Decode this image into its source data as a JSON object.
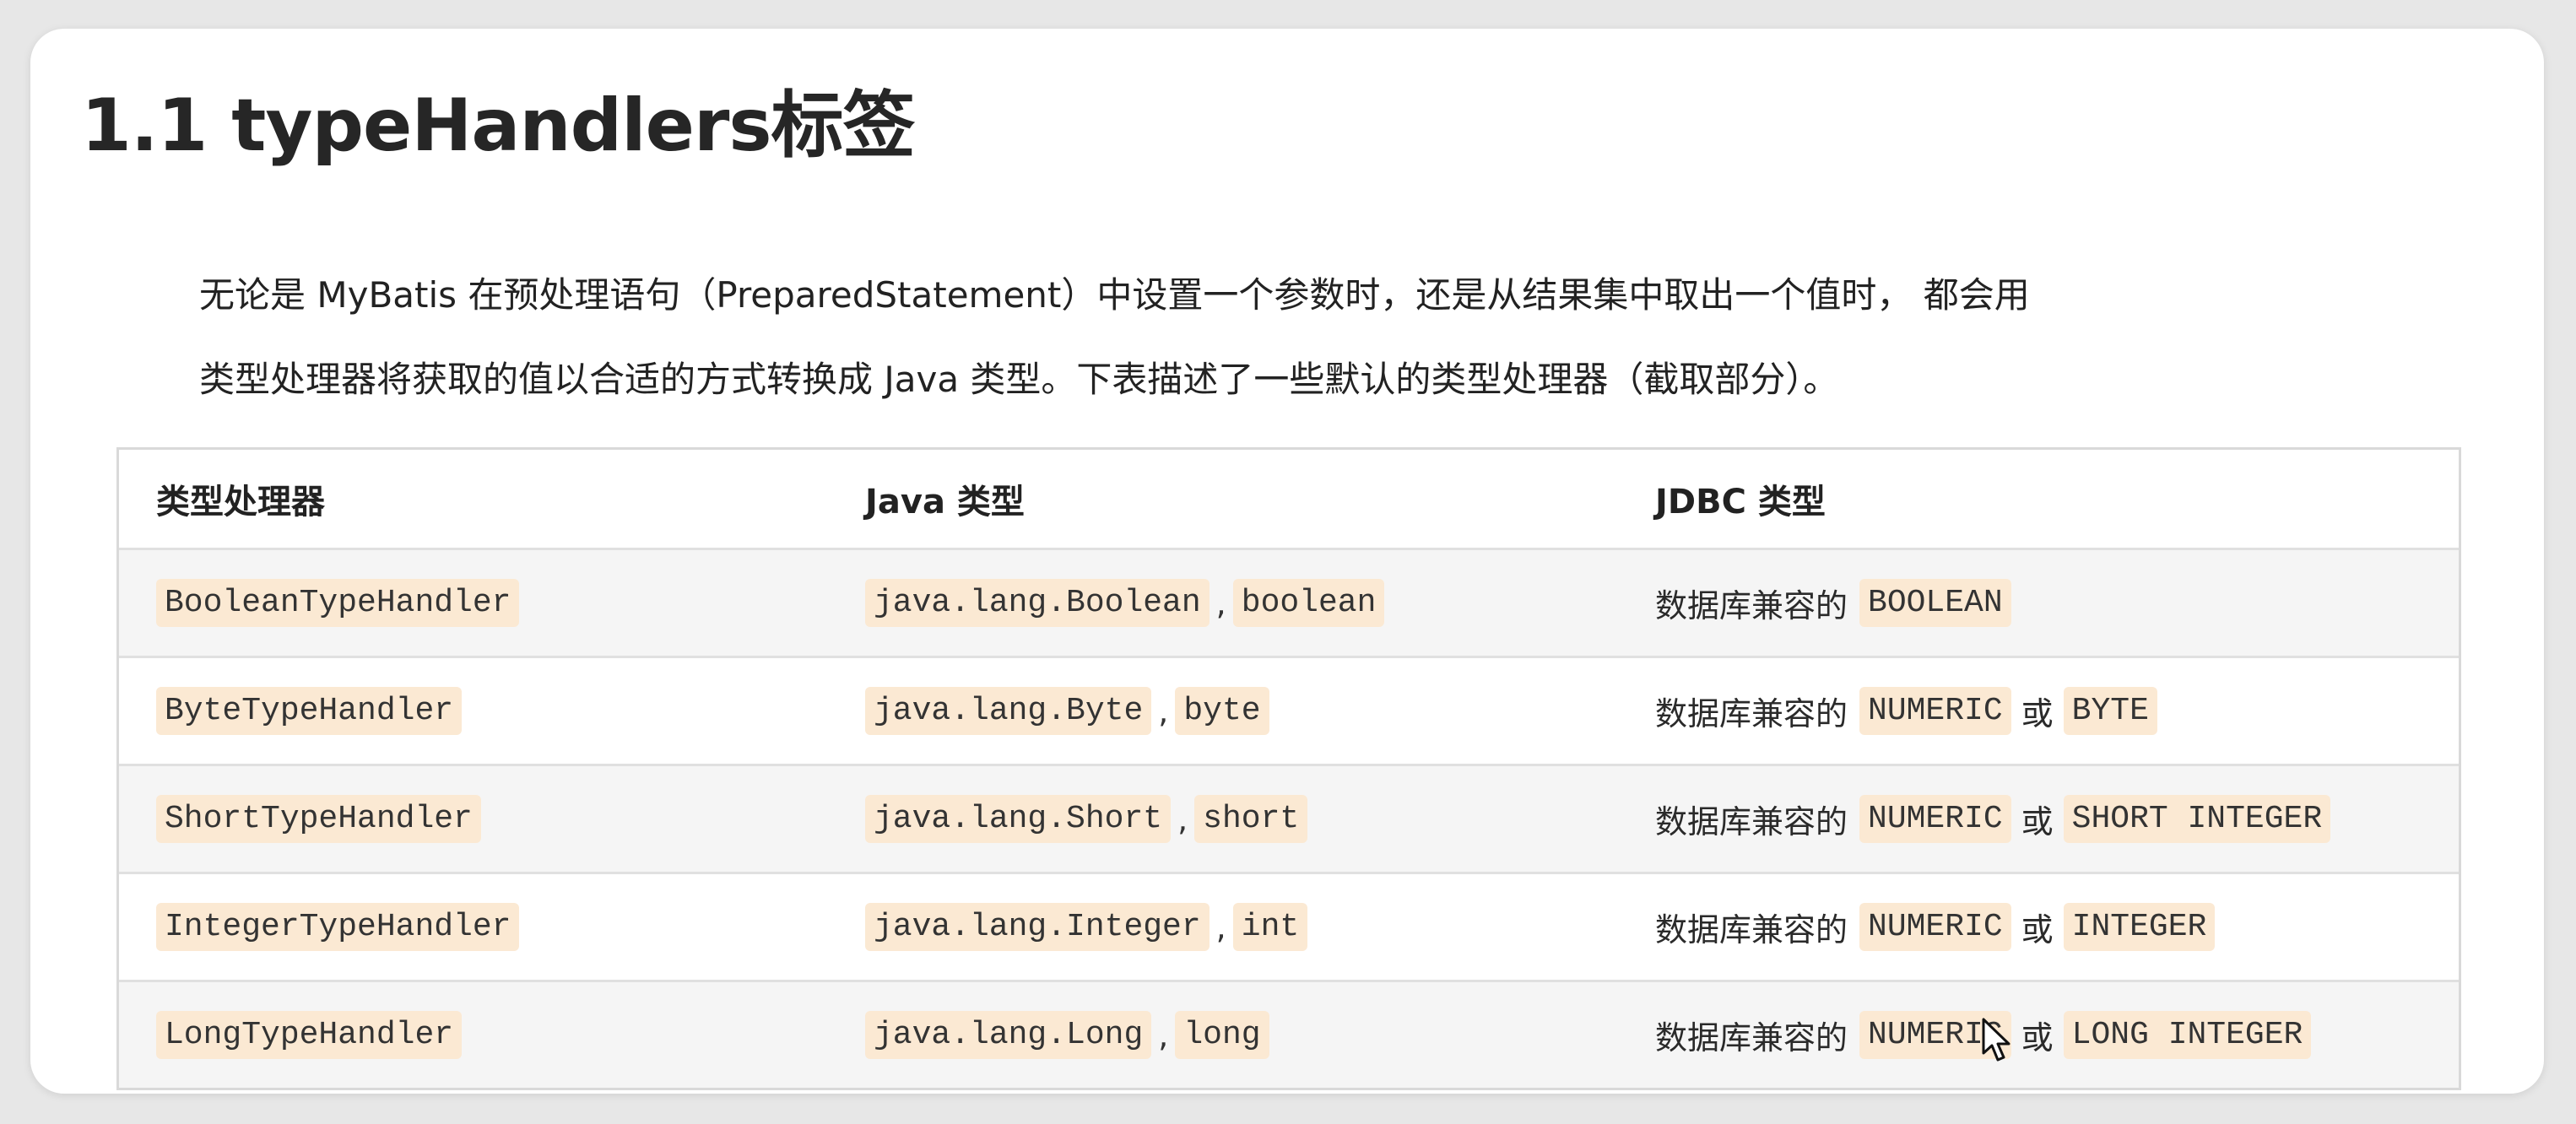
{
  "title": "1.1 typeHandlers标签",
  "paragraph": {
    "line1": "无论是 MyBatis 在预处理语句（PreparedStatement）中设置一个参数时，还是从结果集中取出一个值时， 都会用",
    "line2": "类型处理器将获取的值以合适的方式转换成 Java 类型。下表描述了一些默认的类型处理器（截取部分）。"
  },
  "table": {
    "headers": [
      "类型处理器",
      "Java 类型",
      "JDBC 类型"
    ],
    "jdbc_prefix": "数据库兼容的",
    "or_word": "或",
    "comma": ",",
    "rows": [
      {
        "handler": "BooleanTypeHandler",
        "java_class": "java.lang.Boolean",
        "java_primitive": "boolean",
        "jdbc_first": "BOOLEAN",
        "jdbc_second": ""
      },
      {
        "handler": "ByteTypeHandler",
        "java_class": "java.lang.Byte",
        "java_primitive": "byte",
        "jdbc_first": "NUMERIC",
        "jdbc_second": "BYTE"
      },
      {
        "handler": "ShortTypeHandler",
        "java_class": "java.lang.Short",
        "java_primitive": "short",
        "jdbc_first": "NUMERIC",
        "jdbc_second": "SHORT INTEGER"
      },
      {
        "handler": "IntegerTypeHandler",
        "java_class": "java.lang.Integer",
        "java_primitive": "int",
        "jdbc_first": "NUMERIC",
        "jdbc_second": "INTEGER"
      },
      {
        "handler": "LongTypeHandler",
        "java_class": "java.lang.Long",
        "java_primitive": "long",
        "jdbc_first": "NUMERIC",
        "jdbc_second": "LONG INTEGER"
      }
    ]
  },
  "colors": {
    "code_bg": "#fbe9d3",
    "stripe_bg": "#f5f5f5",
    "border": "#d9d9d9"
  },
  "icons": {
    "cursor": "mouse-pointer-icon"
  }
}
